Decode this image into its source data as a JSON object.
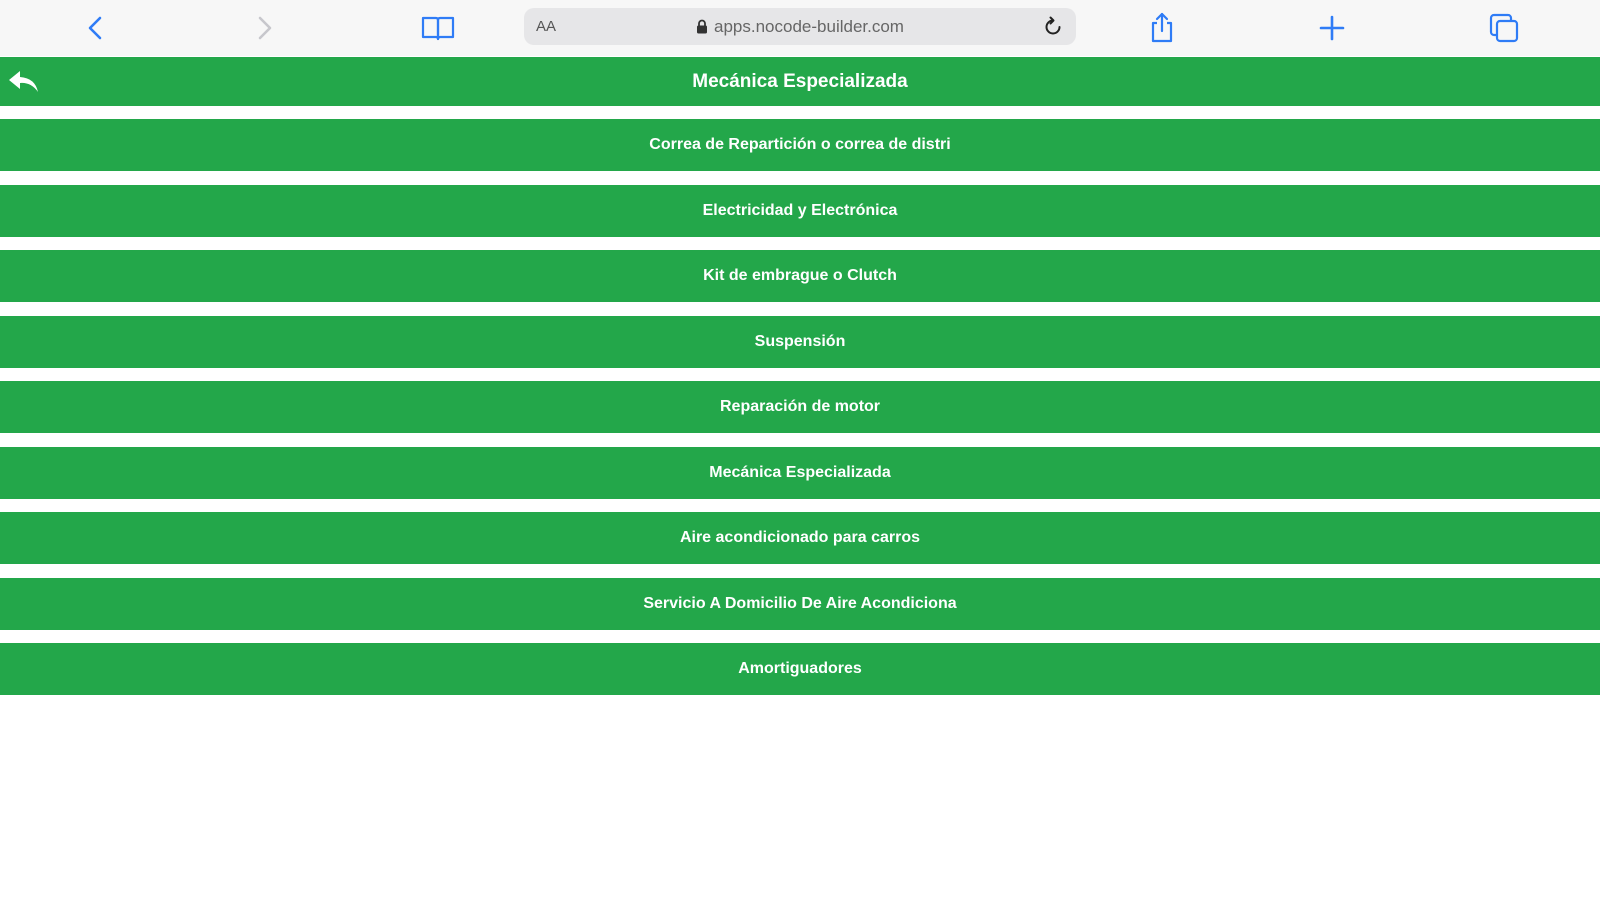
{
  "browser": {
    "url_text_size_label": "AA",
    "url": "apps.nocode-builder.com",
    "icons": {
      "back": "chevron-left-icon",
      "forward": "chevron-right-icon",
      "bookmarks": "book-icon",
      "lock": "lock-icon",
      "reload": "reload-icon",
      "share": "share-icon",
      "new_tab": "plus-icon",
      "tabs": "tabs-icon"
    },
    "accent_color": "#2f7cf6",
    "disabled_color": "#c7c7cc"
  },
  "header": {
    "title": "Mecánica Especializada",
    "back_icon": "reply-arrow-icon",
    "background_color": "#23a74a"
  },
  "services": [
    {
      "label": "Correa de Repartición o correa de distri"
    },
    {
      "label": "Electricidad y Electrónica"
    },
    {
      "label": "Kit de embrague o Clutch"
    },
    {
      "label": "Suspensión"
    },
    {
      "label": "Reparación de motor"
    },
    {
      "label": "Mecánica Especializada"
    },
    {
      "label": "Aire acondicionado para carros"
    },
    {
      "label": "Servicio A Domicilio De Aire Acondiciona"
    },
    {
      "label": "Amortiguadores"
    }
  ]
}
